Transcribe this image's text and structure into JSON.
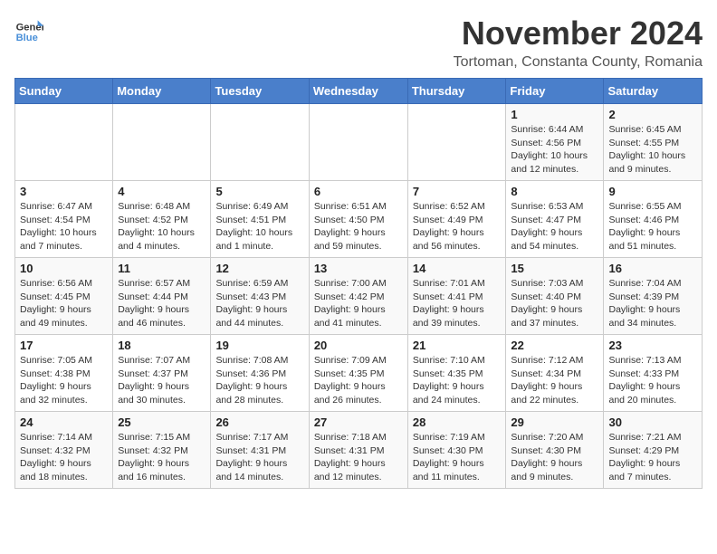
{
  "logo": {
    "general": "General",
    "blue": "Blue"
  },
  "title": "November 2024",
  "subtitle": "Tortoman, Constanta County, Romania",
  "days_of_week": [
    "Sunday",
    "Monday",
    "Tuesday",
    "Wednesday",
    "Thursday",
    "Friday",
    "Saturday"
  ],
  "weeks": [
    [
      {
        "day": "",
        "info": ""
      },
      {
        "day": "",
        "info": ""
      },
      {
        "day": "",
        "info": ""
      },
      {
        "day": "",
        "info": ""
      },
      {
        "day": "",
        "info": ""
      },
      {
        "day": "1",
        "info": "Sunrise: 6:44 AM\nSunset: 4:56 PM\nDaylight: 10 hours and 12 minutes."
      },
      {
        "day": "2",
        "info": "Sunrise: 6:45 AM\nSunset: 4:55 PM\nDaylight: 10 hours and 9 minutes."
      }
    ],
    [
      {
        "day": "3",
        "info": "Sunrise: 6:47 AM\nSunset: 4:54 PM\nDaylight: 10 hours and 7 minutes."
      },
      {
        "day": "4",
        "info": "Sunrise: 6:48 AM\nSunset: 4:52 PM\nDaylight: 10 hours and 4 minutes."
      },
      {
        "day": "5",
        "info": "Sunrise: 6:49 AM\nSunset: 4:51 PM\nDaylight: 10 hours and 1 minute."
      },
      {
        "day": "6",
        "info": "Sunrise: 6:51 AM\nSunset: 4:50 PM\nDaylight: 9 hours and 59 minutes."
      },
      {
        "day": "7",
        "info": "Sunrise: 6:52 AM\nSunset: 4:49 PM\nDaylight: 9 hours and 56 minutes."
      },
      {
        "day": "8",
        "info": "Sunrise: 6:53 AM\nSunset: 4:47 PM\nDaylight: 9 hours and 54 minutes."
      },
      {
        "day": "9",
        "info": "Sunrise: 6:55 AM\nSunset: 4:46 PM\nDaylight: 9 hours and 51 minutes."
      }
    ],
    [
      {
        "day": "10",
        "info": "Sunrise: 6:56 AM\nSunset: 4:45 PM\nDaylight: 9 hours and 49 minutes."
      },
      {
        "day": "11",
        "info": "Sunrise: 6:57 AM\nSunset: 4:44 PM\nDaylight: 9 hours and 46 minutes."
      },
      {
        "day": "12",
        "info": "Sunrise: 6:59 AM\nSunset: 4:43 PM\nDaylight: 9 hours and 44 minutes."
      },
      {
        "day": "13",
        "info": "Sunrise: 7:00 AM\nSunset: 4:42 PM\nDaylight: 9 hours and 41 minutes."
      },
      {
        "day": "14",
        "info": "Sunrise: 7:01 AM\nSunset: 4:41 PM\nDaylight: 9 hours and 39 minutes."
      },
      {
        "day": "15",
        "info": "Sunrise: 7:03 AM\nSunset: 4:40 PM\nDaylight: 9 hours and 37 minutes."
      },
      {
        "day": "16",
        "info": "Sunrise: 7:04 AM\nSunset: 4:39 PM\nDaylight: 9 hours and 34 minutes."
      }
    ],
    [
      {
        "day": "17",
        "info": "Sunrise: 7:05 AM\nSunset: 4:38 PM\nDaylight: 9 hours and 32 minutes."
      },
      {
        "day": "18",
        "info": "Sunrise: 7:07 AM\nSunset: 4:37 PM\nDaylight: 9 hours and 30 minutes."
      },
      {
        "day": "19",
        "info": "Sunrise: 7:08 AM\nSunset: 4:36 PM\nDaylight: 9 hours and 28 minutes."
      },
      {
        "day": "20",
        "info": "Sunrise: 7:09 AM\nSunset: 4:35 PM\nDaylight: 9 hours and 26 minutes."
      },
      {
        "day": "21",
        "info": "Sunrise: 7:10 AM\nSunset: 4:35 PM\nDaylight: 9 hours and 24 minutes."
      },
      {
        "day": "22",
        "info": "Sunrise: 7:12 AM\nSunset: 4:34 PM\nDaylight: 9 hours and 22 minutes."
      },
      {
        "day": "23",
        "info": "Sunrise: 7:13 AM\nSunset: 4:33 PM\nDaylight: 9 hours and 20 minutes."
      }
    ],
    [
      {
        "day": "24",
        "info": "Sunrise: 7:14 AM\nSunset: 4:32 PM\nDaylight: 9 hours and 18 minutes."
      },
      {
        "day": "25",
        "info": "Sunrise: 7:15 AM\nSunset: 4:32 PM\nDaylight: 9 hours and 16 minutes."
      },
      {
        "day": "26",
        "info": "Sunrise: 7:17 AM\nSunset: 4:31 PM\nDaylight: 9 hours and 14 minutes."
      },
      {
        "day": "27",
        "info": "Sunrise: 7:18 AM\nSunset: 4:31 PM\nDaylight: 9 hours and 12 minutes."
      },
      {
        "day": "28",
        "info": "Sunrise: 7:19 AM\nSunset: 4:30 PM\nDaylight: 9 hours and 11 minutes."
      },
      {
        "day": "29",
        "info": "Sunrise: 7:20 AM\nSunset: 4:30 PM\nDaylight: 9 hours and 9 minutes."
      },
      {
        "day": "30",
        "info": "Sunrise: 7:21 AM\nSunset: 4:29 PM\nDaylight: 9 hours and 7 minutes."
      }
    ]
  ]
}
